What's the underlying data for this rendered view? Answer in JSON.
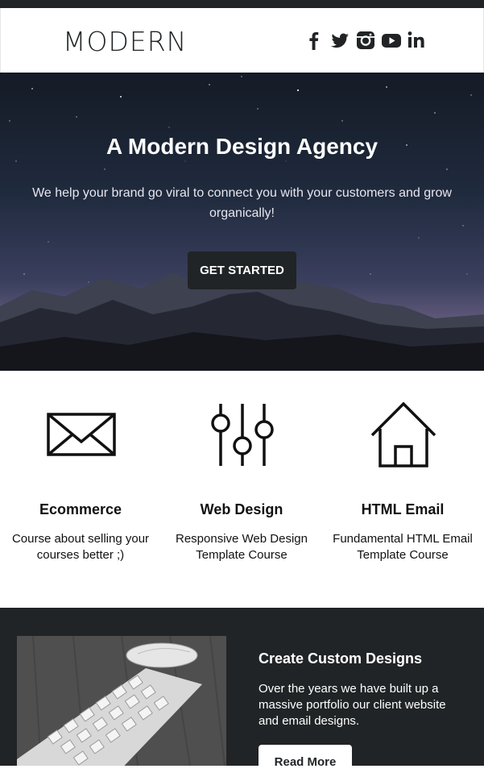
{
  "header": {
    "logo": "MODERN",
    "social": [
      {
        "icon": "facebook-icon",
        "glyph": "f"
      },
      {
        "icon": "twitter-icon"
      },
      {
        "icon": "instagram-icon"
      },
      {
        "icon": "youtube-icon"
      },
      {
        "icon": "linkedin-icon",
        "glyph": "in"
      }
    ]
  },
  "hero": {
    "title": "A Modern Design Agency",
    "text": "We help your brand go viral to connect you with your customers and grow organically!",
    "cta_label": "GET STARTED"
  },
  "features": [
    {
      "icon": "envelope-icon",
      "title": "Ecommerce",
      "text": "Course about selling your courses better ;)"
    },
    {
      "icon": "sliders-icon",
      "title": "Web Design",
      "text": "Responsive Web Design Template Course"
    },
    {
      "icon": "house-icon",
      "title": "HTML Email",
      "text": "Fundamental HTML Email Template Course"
    }
  ],
  "promo": {
    "title": "Create Custom Designs",
    "text": "Over the years we have built up a massive portfolio our client website and email designs.",
    "button_label": "Read More"
  },
  "colors": {
    "dark": "#212426",
    "white": "#ffffff"
  }
}
